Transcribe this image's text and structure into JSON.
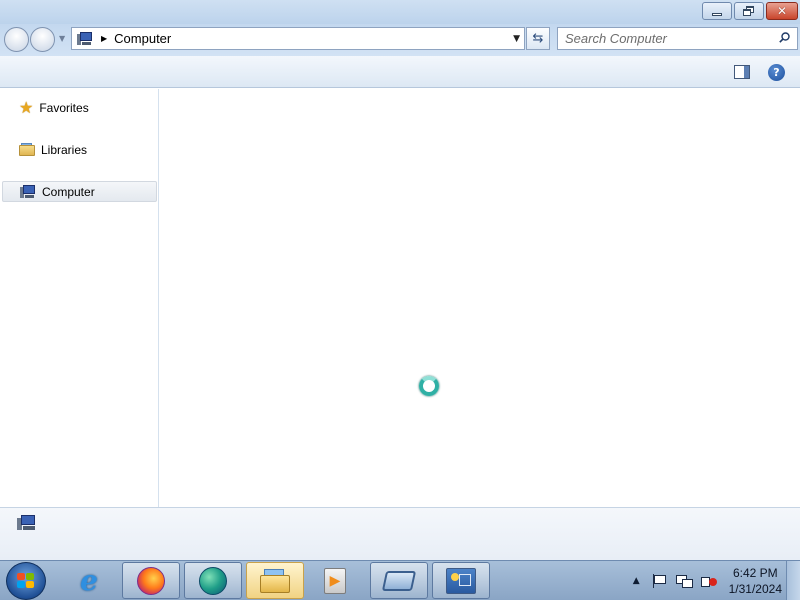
{
  "window": {
    "address": {
      "crumbs": [
        "Computer"
      ]
    },
    "search": {
      "placeholder": "Search Computer"
    },
    "nav_pane": {
      "items": [
        {
          "label": "Favorites",
          "icon": "star-icon"
        },
        {
          "label": "Libraries",
          "icon": "libraries-icon"
        },
        {
          "label": "Computer",
          "icon": "computer-icon",
          "selected": true
        }
      ]
    },
    "content": {
      "state": "loading",
      "icon": "busy-icon"
    },
    "toolbar_icons": [
      "preview-pane-icon",
      "help-icon"
    ]
  },
  "taskbar": {
    "start_icon": "windows-flag-icon",
    "pinned": [
      {
        "name": "internet-explorer",
        "icon": "ie-icon"
      },
      {
        "name": "firefox",
        "icon": "firefox-icon"
      },
      {
        "name": "edge",
        "icon": "edge-icon"
      },
      {
        "name": "windows-explorer",
        "icon": "explorer-icon",
        "active": true
      },
      {
        "name": "media-player",
        "icon": "media-player-icon"
      },
      {
        "name": "remote-desktop",
        "icon": "remote-desktop-icon"
      },
      {
        "name": "control-panel",
        "icon": "control-panel-icon"
      }
    ],
    "tray_icons": [
      "show-hidden-icons",
      "action-center-flag-icon",
      "network-icon",
      "volume-muted-icon"
    ],
    "clock": {
      "time": "6:42 PM",
      "date": "1/31/2024"
    }
  },
  "colors": {
    "close_button": "#c9452c",
    "selection": "#e4e9ef",
    "busy_ring": "#2fb0a5"
  }
}
